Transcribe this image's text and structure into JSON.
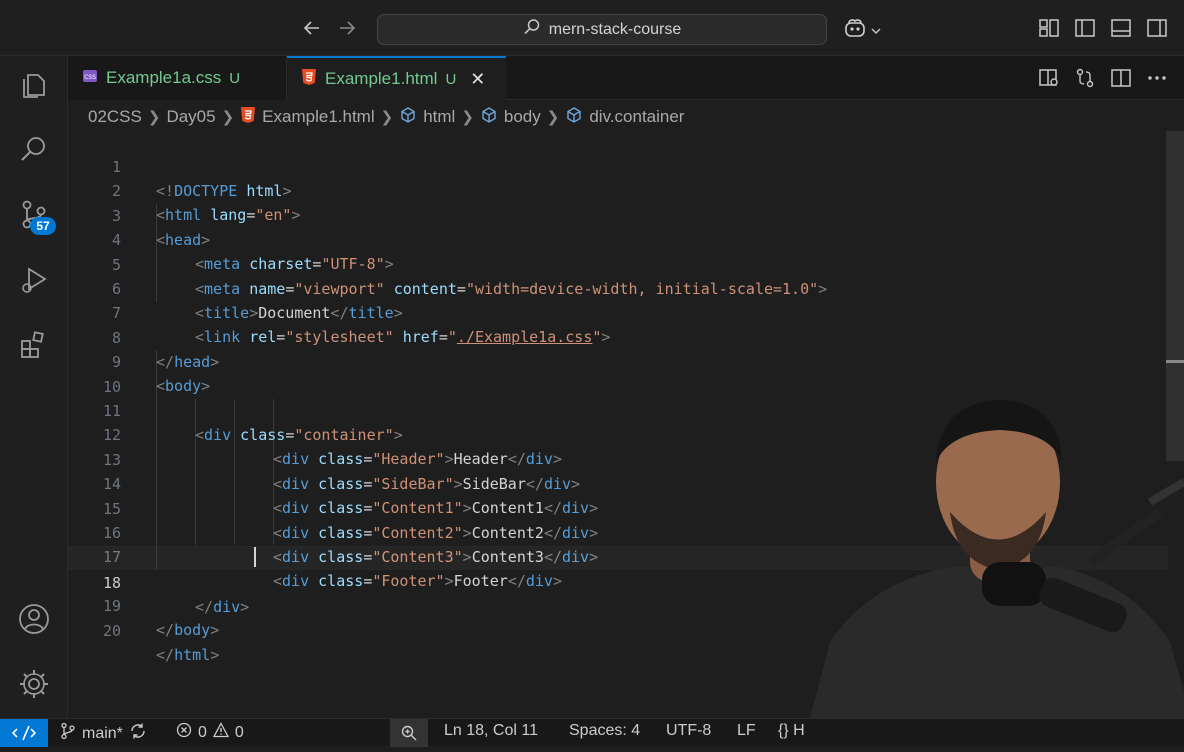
{
  "titlebar": {
    "search_text": "mern-stack-course",
    "back_icon": "arrow-left-icon",
    "forward_icon": "arrow-right-icon"
  },
  "activity": {
    "source_control_badge": "57"
  },
  "tabs": [
    {
      "label": "Example1a.css",
      "status": "U",
      "icon": "css-file-icon",
      "active": false
    },
    {
      "label": "Example1.html",
      "status": "U",
      "icon": "html-file-icon",
      "active": true
    }
  ],
  "breadcrumb": {
    "items": [
      "02CSS",
      "Day05",
      "Example1.html",
      "html",
      "body",
      "div.container"
    ]
  },
  "code": {
    "lines": [
      {
        "n": "1"
      },
      {
        "n": "2"
      },
      {
        "n": "3"
      },
      {
        "n": "4"
      },
      {
        "n": "5"
      },
      {
        "n": "6"
      },
      {
        "n": "7"
      },
      {
        "n": "8"
      },
      {
        "n": "9"
      },
      {
        "n": "10"
      },
      {
        "n": "11"
      },
      {
        "n": "12"
      },
      {
        "n": "13"
      },
      {
        "n": "14"
      },
      {
        "n": "15"
      },
      {
        "n": "16"
      },
      {
        "n": "17"
      },
      {
        "n": "18"
      },
      {
        "n": "19"
      },
      {
        "n": "20"
      }
    ],
    "text": {
      "l1": [
        "<!",
        "DOCTYPE",
        " ",
        "html",
        ">"
      ],
      "l2": [
        "<",
        "html",
        " ",
        "lang",
        "=",
        "\"en\"",
        ">"
      ],
      "l3": [
        "<",
        "head",
        ">"
      ],
      "l4": [
        "<",
        "meta",
        " ",
        "charset",
        "=",
        "\"UTF-8\"",
        ">"
      ],
      "l5": [
        "<",
        "meta",
        " ",
        "name",
        "=",
        "\"viewport\"",
        " ",
        "content",
        "=",
        "\"width=device-width, initial-scale=1.0\"",
        ">"
      ],
      "l6": [
        "<",
        "title",
        ">",
        "Document",
        "</",
        "title",
        ">"
      ],
      "l7": [
        "<",
        "link",
        " ",
        "rel",
        "=",
        "\"stylesheet\"",
        " ",
        "href",
        "=",
        "\"",
        "./Example1a.css",
        "\"",
        ">"
      ],
      "l8": [
        "</",
        "head",
        ">"
      ],
      "l9": [
        "<",
        "body",
        ">"
      ],
      "l11": [
        "<",
        "div",
        " ",
        "class",
        "=",
        "\"container\"",
        ">"
      ],
      "l12": [
        "<",
        "div",
        " ",
        "class",
        "=",
        "\"Header\"",
        ">",
        "Header",
        "</",
        "div",
        ">"
      ],
      "l13": [
        "<",
        "div",
        " ",
        "class",
        "=",
        "\"SideBar\"",
        ">",
        "SideBar",
        "</",
        "div",
        ">"
      ],
      "l14": [
        "<",
        "div",
        " ",
        "class",
        "=",
        "\"Content1\"",
        ">",
        "Content1",
        "</",
        "div",
        ">"
      ],
      "l15": [
        "<",
        "div",
        " ",
        "class",
        "=",
        "\"Content2\"",
        ">",
        "Content2",
        "</",
        "div",
        ">"
      ],
      "l16": [
        "<",
        "div",
        " ",
        "class",
        "=",
        "\"Content3\"",
        ">",
        "Content3",
        "</",
        "div",
        ">"
      ],
      "l17": [
        "<",
        "div",
        " ",
        "class",
        "=",
        "\"Footer\"",
        ">",
        "Footer",
        "</",
        "div",
        ">"
      ],
      "l18": [
        "</",
        "div",
        ">"
      ],
      "l19": [
        "</",
        "body",
        ">"
      ],
      "l20": [
        "</",
        "html",
        ">"
      ]
    }
  },
  "statusbar": {
    "branch": "main*",
    "errors": "0",
    "warnings": "0",
    "position": "Ln 18, Col 11",
    "spaces": "Spaces: 4",
    "encoding": "UTF-8",
    "eol": "LF",
    "language": "{} H"
  },
  "colors": {
    "accent": "#0078d4",
    "untracked": "#73c991",
    "tag": "#569cd6",
    "attr": "#9cdcfe",
    "string": "#ce9178"
  }
}
